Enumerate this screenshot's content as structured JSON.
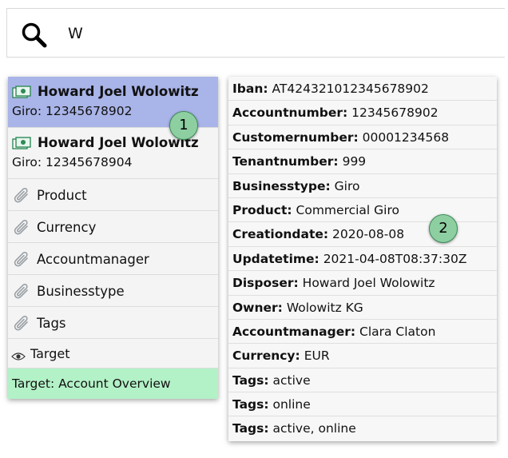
{
  "search": {
    "value": "W",
    "placeholder": ""
  },
  "suggestions": {
    "accounts": [
      {
        "name": "Howard Joel Wolowitz",
        "sub": "Giro: 12345678902",
        "selected": true
      },
      {
        "name": "Howard Joel Wolowitz",
        "sub": "Giro: 12345678904",
        "selected": false
      }
    ],
    "tags": [
      {
        "label": "Product",
        "icon": "paperclip-icon"
      },
      {
        "label": "Currency",
        "icon": "paperclip-icon"
      },
      {
        "label": "Accountmanager",
        "icon": "paperclip-icon"
      },
      {
        "label": "Businesstype",
        "icon": "paperclip-icon"
      },
      {
        "label": "Tags",
        "icon": "paperclip-icon"
      }
    ],
    "target": {
      "label": "Target",
      "icon": "eye-icon"
    },
    "target_status": "Target: Account Overview"
  },
  "detail": {
    "fields": [
      {
        "key": "Iban:",
        "value": "AT424321012345678902"
      },
      {
        "key": "Accountnumber:",
        "value": "12345678902"
      },
      {
        "key": "Customernumber:",
        "value": "00001234568"
      },
      {
        "key": "Tenantnumber:",
        "value": "999"
      },
      {
        "key": "Businesstype:",
        "value": "Giro"
      },
      {
        "key": "Product:",
        "value": "Commercial Giro"
      },
      {
        "key": "Creationdate:",
        "value": "2020-08-08"
      },
      {
        "key": "Updatetime:",
        "value": "2021-04-08T08:37:30Z"
      },
      {
        "key": "Disposer:",
        "value": "Howard Joel Wolowitz"
      },
      {
        "key": "Owner:",
        "value": "Wolowitz KG"
      },
      {
        "key": "Accountmanager:",
        "value": "Clara Claton"
      },
      {
        "key": "Currency:",
        "value": "EUR"
      },
      {
        "key": "Tags:",
        "value": "active"
      },
      {
        "key": "Tags:",
        "value": "online"
      },
      {
        "key": "Tags:",
        "value": "active, online"
      }
    ]
  },
  "badges": [
    "1",
    "2"
  ],
  "colors": {
    "selected": "#a9b4e8",
    "target_status": "#b3f1c7",
    "badge": "#8ecfa2",
    "money_icon": "#2e8b57"
  }
}
